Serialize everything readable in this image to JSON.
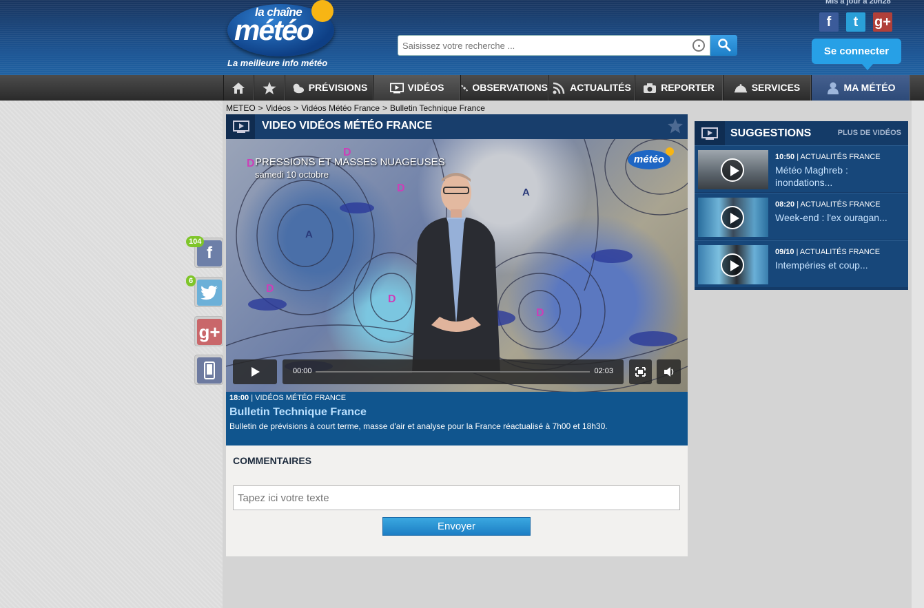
{
  "header": {
    "logo_small": "la chaîne",
    "logo_big": "météo",
    "tagline": "La meilleure info météo",
    "updated": "Mis à jour à 20h28",
    "search_placeholder": "Saisissez votre recherche ...",
    "connect_label": "Se connecter",
    "social": [
      "f",
      "t",
      "g+"
    ]
  },
  "nav": {
    "items": [
      {
        "label": "",
        "icon": "home-icon"
      },
      {
        "label": "",
        "icon": "star-icon"
      },
      {
        "label": "PRÉVISIONS",
        "icon": "weather-icon"
      },
      {
        "label": "VIDÉOS",
        "icon": "video-icon"
      },
      {
        "label": "OBSERVATIONS",
        "icon": "satellite-icon"
      },
      {
        "label": "ACTUALITÉS",
        "icon": "rss-icon"
      },
      {
        "label": "REPORTER",
        "icon": "camera-icon"
      },
      {
        "label": "SERVICES",
        "icon": "bell-icon"
      },
      {
        "label": "MA MÉTÉO",
        "icon": "user-icon"
      }
    ]
  },
  "breadcrumb": [
    "METEO",
    ">",
    "Vidéos",
    ">",
    "Vidéos Météo France",
    ">",
    "Bulletin Technique France"
  ],
  "video": {
    "header_title": "VIDEO VIDÉOS MÉTÉO FRANCE",
    "caption_line1": "PRESSIONS ET MASSES NUAGEUSES",
    "caption_line2": "samedi 10 octobre",
    "overlay_logo": "météo",
    "time_current": "00:00",
    "time_total": "02:03",
    "meta_time": "18:00",
    "meta_category": "| VIDÉOS MÉTÉO FRANCE",
    "title": "Bulletin Technique France",
    "description": "Bulletin de prévisions à court terme, masse d'air et analyse pour la France réactualisé à 7h00 et 18h30."
  },
  "comments": {
    "title": "COMMENTAIRES",
    "placeholder": "Tapez ici votre texte",
    "send_label": "Envoyer"
  },
  "suggestions": {
    "title": "SUGGESTIONS",
    "more": "PLUS DE VIDÉOS",
    "items": [
      {
        "time": "10:50",
        "category": "| ACTUALITÉS FRANCE",
        "text": "Météo Maghreb : inondations..."
      },
      {
        "time": "08:20",
        "category": "| ACTUALITÉS FRANCE",
        "text": "Week-end : l'ex ouragan..."
      },
      {
        "time": "09/10",
        "category": "| ACTUALITÉS FRANCE",
        "text": "Intempéries et coup..."
      }
    ]
  },
  "share": {
    "facebook_count": "104",
    "twitter_count": "6"
  },
  "colors": {
    "header_blue": "#1d5594",
    "accent_blue": "#27a0e6",
    "badge_green": "#7fc52a"
  }
}
